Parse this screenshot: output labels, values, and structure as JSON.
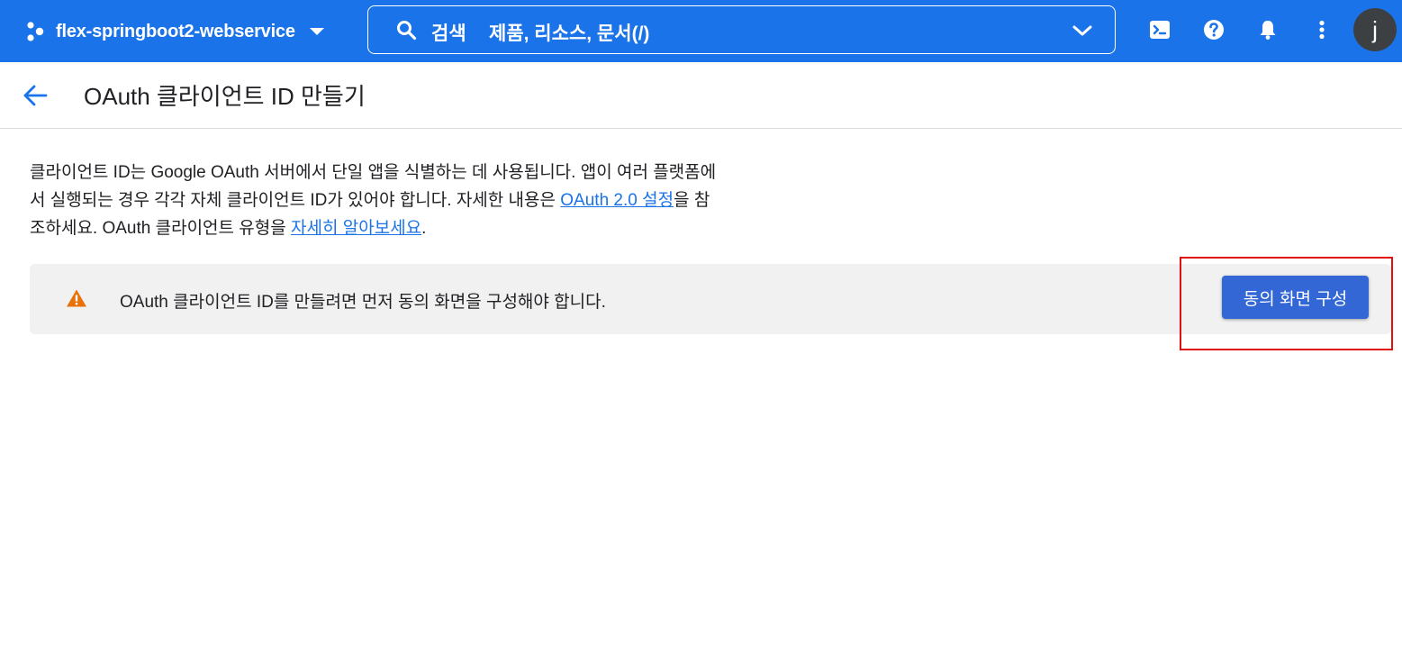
{
  "topbar": {
    "project_name": "flex-springboot2-webservice",
    "search_keyword": "검색",
    "search_placeholder": "제품, 리소스, 문서(/)",
    "avatar_letter": "j"
  },
  "header": {
    "title": "OAuth 클라이언트 ID 만들기"
  },
  "description": {
    "text_1": "클라이언트 ID는 Google OAuth 서버에서 단일 앱을 식별하는 데 사용됩니다. 앱이 여러 플랫폼에서 실행되는 경우 각각 자체 클라이언트 ID가 있어야 합니다. 자세한 내용은 ",
    "link_1": "OAuth 2.0 설정",
    "text_2": "을 참조하세요. OAuth 클라이언트 유형을 ",
    "link_2": "자세히 알아보세요",
    "text_3": "."
  },
  "alert": {
    "message": "OAuth 클라이언트 ID를 만들려면 먼저 동의 화면을 구성해야 합니다.",
    "button_label": "동의 화면 구성"
  },
  "colors": {
    "topbar_bg": "#1a73e8",
    "link": "#1a73e8",
    "button_bg": "#3367d6",
    "warning": "#e8710a",
    "highlight": "#e01010"
  },
  "icons": {
    "project": "project-hexagon-icon",
    "search": "search-icon",
    "search_expand": "chevron-down-icon",
    "cloud_shell": "cloud-shell-icon",
    "help": "help-icon",
    "notifications": "bell-icon",
    "more": "more-vert-icon",
    "back": "arrow-back-icon",
    "warning": "warning-icon"
  }
}
